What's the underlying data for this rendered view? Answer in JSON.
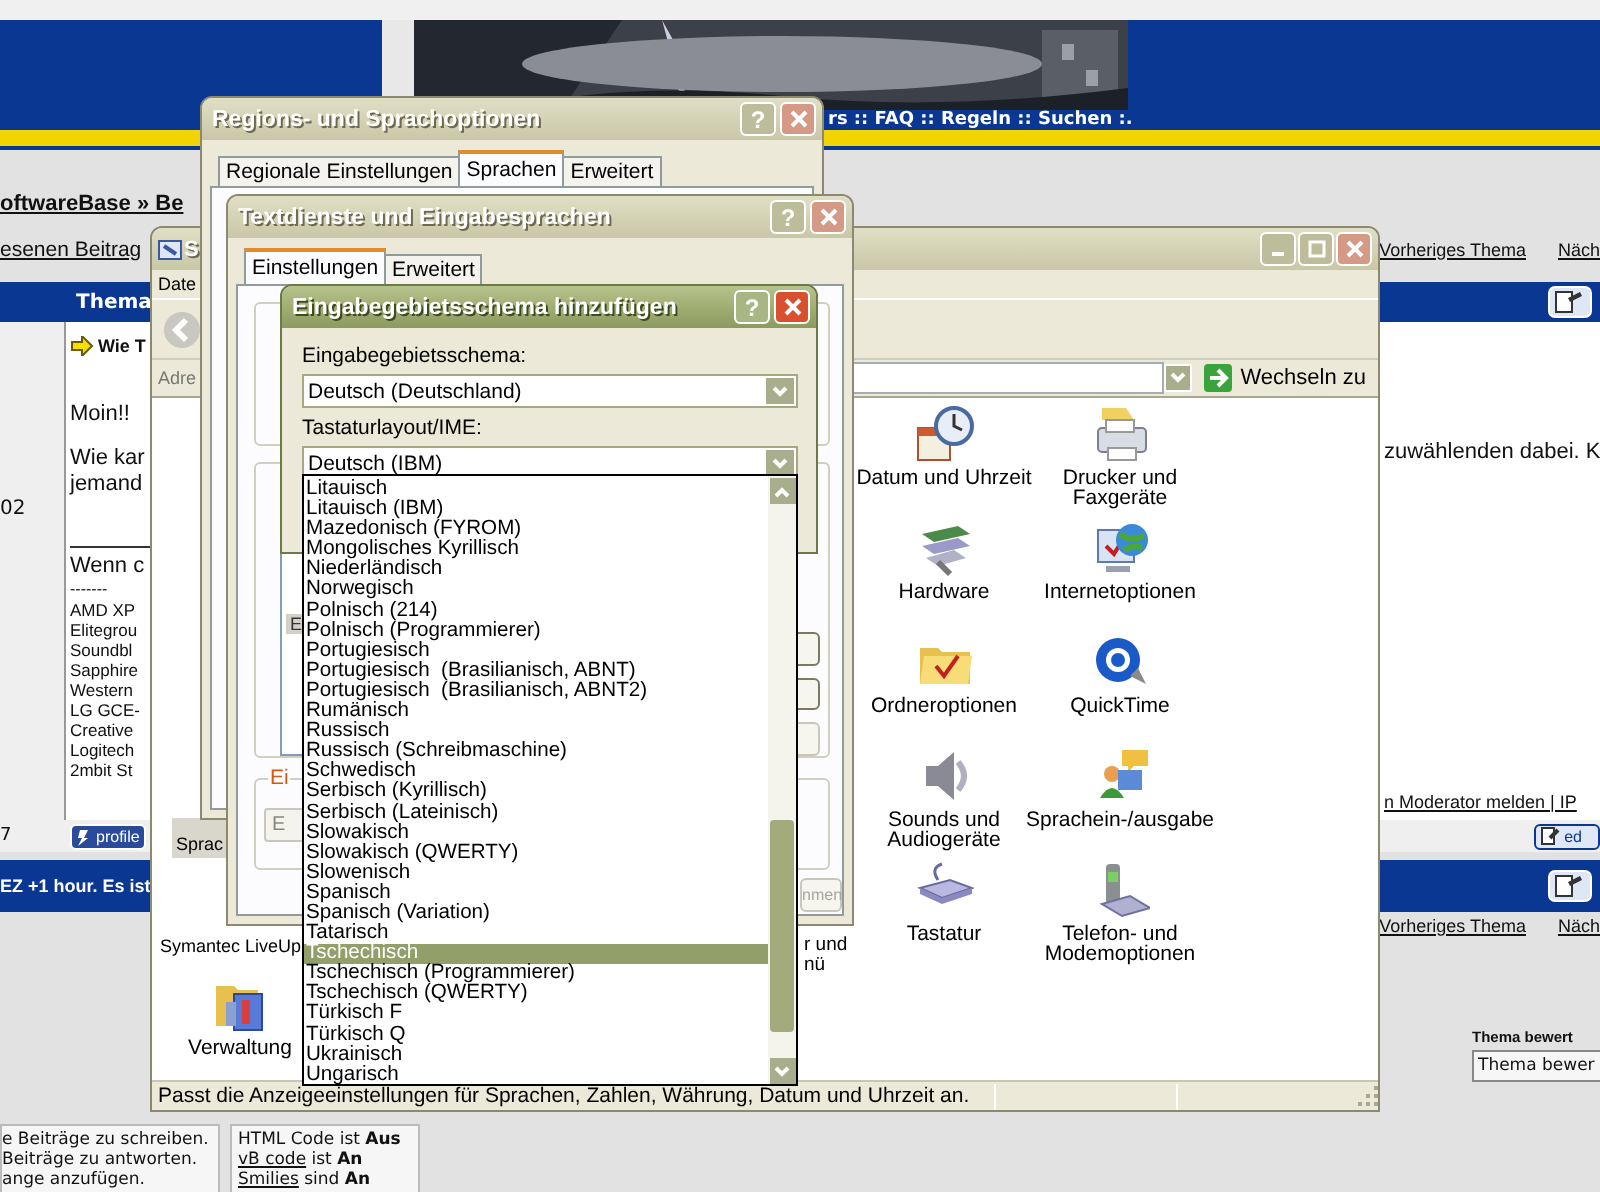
{
  "forum": {
    "nav": "rs :: FAQ :: Regeln :: Suchen :.",
    "breadcrumb": "oftwareBase » Be",
    "top_links": {
      "left": "esenen Beitrag",
      "right": [
        "Vorheriges Thema",
        "Näch"
      ]
    },
    "thread_header": "Thema",
    "post": {
      "side_number": "02",
      "title": "Wie T",
      "lines": [
        "Moin!!",
        "Wie kar",
        "jemand"
      ],
      "line_right": "zuwählenden dabei. K",
      "signature_intro": "Wenn c",
      "signature_rule": "-------",
      "signature": [
        "AMD XP",
        "Elitegrou",
        "Soundbl",
        "Sapphire",
        "Western",
        "LG GCE-",
        "Creative",
        "Logitech",
        "2mbit St"
      ],
      "report": "n Moderator melden | IP"
    },
    "post_footer": {
      "number": "7",
      "profile": "profile",
      "edit": "ed"
    },
    "time_bar": "EZ +1 hour. Es ist",
    "bottom_links": [
      "Vorheriges Thema",
      "Näch"
    ],
    "rating": {
      "label": "Thema bewert",
      "value": "Thema bewer"
    },
    "permissions": [
      "e Beiträge zu schreiben.",
      "Beiträge zu antworten.",
      "ange anzufügen."
    ],
    "settings": [
      {
        "label": "HTML Code",
        "link": false,
        "verb": "ist",
        "value": "Aus"
      },
      {
        "label": "vB code",
        "link": true,
        "verb": "ist",
        "value": "An"
      },
      {
        "label": "Smilies",
        "link": true,
        "verb": "sind",
        "value": "An"
      }
    ]
  },
  "control_panel": {
    "title": "S",
    "active": false,
    "menu": [
      "Date"
    ],
    "address_label": "Adre",
    "go_button": "Wechseln zu",
    "items": [
      {
        "kind": "icon",
        "label": "Datum und Uhrzeit",
        "selected": false
      },
      {
        "kind": "icon",
        "label": "Drucker und\nFaxgeräte",
        "selected": false
      },
      {
        "kind": "icon",
        "label": "Hardware",
        "selected": false
      },
      {
        "kind": "icon",
        "label": "Internetoptionen",
        "selected": false
      },
      {
        "kind": "icon",
        "label": "Ordneroptionen",
        "selected": false
      },
      {
        "kind": "icon",
        "label": "QuickTime",
        "selected": false
      },
      {
        "kind": "label",
        "label": "Sprac",
        "selected": true
      },
      {
        "kind": "icon",
        "label": "Sounds und\nAudiogeräte",
        "selected": false
      },
      {
        "kind": "icon",
        "label": "Sprachein-/ausgabe",
        "selected": false
      },
      {
        "kind": "label",
        "label": "Symantec LiveUp",
        "selected": false
      },
      {
        "kind": "label",
        "label": "r und\nnü",
        "selected": false
      },
      {
        "kind": "icon",
        "label": "Tastatur",
        "selected": false
      },
      {
        "kind": "icon",
        "label": "Telefon- und\nModemoptionen",
        "selected": false
      },
      {
        "kind": "icon",
        "label": "Verwaltung",
        "selected": false
      }
    ],
    "status": "Passt die Anzeigeeinstellungen für Sprachen, Zahlen, Währung, Datum und Uhrzeit an."
  },
  "regions_dialog": {
    "title": "Regions- und Sprachoptionen",
    "active": false,
    "help": "?",
    "tabs": [
      {
        "label": "Regionale Einstellungen",
        "selected": false
      },
      {
        "label": "Sprachen",
        "selected": true
      },
      {
        "label": "Erweitert",
        "selected": false
      }
    ]
  },
  "text_services_dialog": {
    "title": "Textdienste und Eingabesprachen",
    "active": false,
    "help": "?",
    "tabs": [
      {
        "label": "Einstellungen",
        "selected": true
      },
      {
        "label": "Erweitert",
        "selected": false
      }
    ],
    "list_item": "E",
    "side_buttons": [
      {
        "disabled": false
      },
      {
        "disabled": false
      },
      {
        "disabled": true
      }
    ],
    "group_label": "Ei",
    "field": {
      "value": "E",
      "disabled": true
    },
    "apply_button": {
      "label": "nmen",
      "disabled": true
    }
  },
  "add_locale_dialog": {
    "title": "Eingabegebietsschema hinzufügen",
    "active": true,
    "help": "?",
    "locale_label": "Eingabegebietsschema:",
    "locale_value": "Deutsch (Deutschland)",
    "layout_label": "Tastaturlayout/IME:",
    "layout_value": "Deutsch (IBM)",
    "layouts": [
      {
        "label": "Litauisch",
        "selected": false
      },
      {
        "label": "Litauisch (IBM)",
        "selected": false
      },
      {
        "label": "Mazedonisch (FYROM)",
        "selected": false
      },
      {
        "label": "Mongolisches Kyrillisch",
        "selected": false
      },
      {
        "label": "Niederländisch",
        "selected": false
      },
      {
        "label": "Norwegisch",
        "selected": false
      },
      {
        "label": "Polnisch (214)",
        "selected": false
      },
      {
        "label": "Polnisch (Programmierer)",
        "selected": false
      },
      {
        "label": "Portugiesisch",
        "selected": false
      },
      {
        "label": "Portugiesisch  (Brasilianisch, ABNT)",
        "selected": false
      },
      {
        "label": "Portugiesisch  (Brasilianisch, ABNT2)",
        "selected": false
      },
      {
        "label": "Rumänisch",
        "selected": false
      },
      {
        "label": "Russisch",
        "selected": false
      },
      {
        "label": "Russisch (Schreibmaschine)",
        "selected": false
      },
      {
        "label": "Schwedisch",
        "selected": false
      },
      {
        "label": "Serbisch (Kyrillisch)",
        "selected": false
      },
      {
        "label": "Serbisch (Lateinisch)",
        "selected": false
      },
      {
        "label": "Slowakisch",
        "selected": false
      },
      {
        "label": "Slowakisch (QWERTY)",
        "selected": false
      },
      {
        "label": "Slowenisch",
        "selected": false
      },
      {
        "label": "Spanisch",
        "selected": false
      },
      {
        "label": "Spanisch (Variation)",
        "selected": false
      },
      {
        "label": "Tatarisch",
        "selected": false
      },
      {
        "label": "Tschechisch",
        "selected": true
      },
      {
        "label": "Tschechisch (Programmierer)",
        "selected": false
      },
      {
        "label": "Tschechisch (QWERTY)",
        "selected": false
      },
      {
        "label": "Türkisch F",
        "selected": false
      },
      {
        "label": "Türkisch Q",
        "selected": false
      },
      {
        "label": "Ukrainisch",
        "selected": false
      },
      {
        "label": "Ungarisch",
        "selected": false
      }
    ]
  }
}
